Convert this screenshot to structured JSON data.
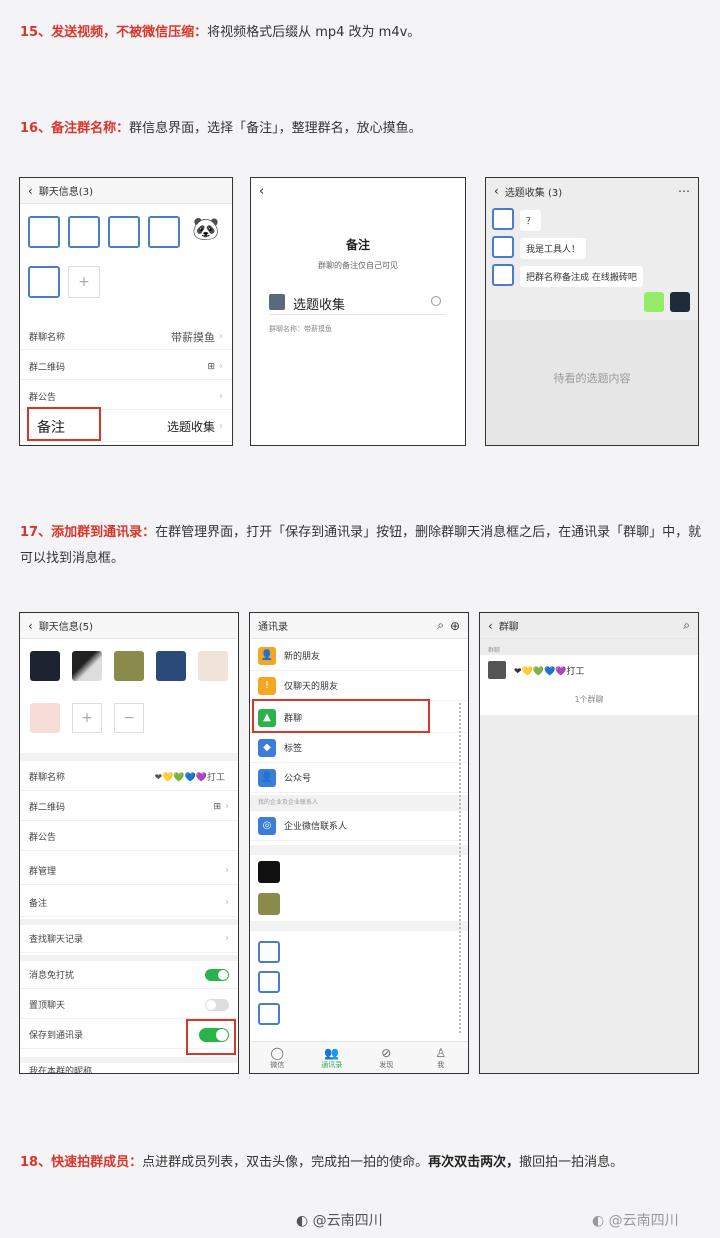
{
  "tip15": {
    "head": "15、发送视频，不被微信压缩：",
    "body": "将视频格式后缀从 mp4 改为 m4v。"
  },
  "tip16": {
    "head": "16、备注群名称：",
    "body": "群信息界面，选择「备注」，整理群名，放心摸鱼。"
  },
  "phone1": {
    "title": "聊天信息(3)",
    "rows": [
      {
        "label": "群聊名称",
        "value": "带薪摸鱼"
      },
      {
        "label": "群二维码",
        "value": "⊞"
      },
      {
        "label": "群公告",
        "value": ""
      }
    ],
    "remark_label": "备注",
    "remark_value": "选题收集"
  },
  "phone2": {
    "title": "备注",
    "subtitle": "群聊的备注仅自己可见",
    "input_value": "选题收集",
    "hint": "群聊名称：带薪摸鱼"
  },
  "phone3": {
    "title": "选题收集",
    "count": "(3)",
    "messages": [
      "？",
      "我是工具人！",
      "把群名称备注成 在线搬砖吧"
    ],
    "empty_hint": "待看的选题内容"
  },
  "tip17": {
    "head": "17、添加群到通讯录：",
    "body": "在群管理界面，打开「保存到通讯录」按钮，删除群聊天消息框之后，在通讯录「群聊」中，就可以找到消息框。"
  },
  "phone4": {
    "title": "聊天信息(5)",
    "rows": [
      {
        "label": "群聊名称",
        "value": "❤💛💚💙💜打工"
      },
      {
        "label": "群二维码",
        "value": "⊞"
      },
      {
        "label": "群公告",
        "value": ""
      },
      {
        "label": "群管理",
        "value": ""
      },
      {
        "label": "备注",
        "value": ""
      },
      {
        "label": "查找聊天记录",
        "value": ""
      }
    ],
    "toggles": [
      {
        "label": "消息免打扰",
        "on": true
      },
      {
        "label": "置顶聊天",
        "on": false
      },
      {
        "label": "保存到通讯录",
        "on": true
      }
    ],
    "last_row": "我在本群的昵称"
  },
  "phone5": {
    "title": "通讯录",
    "entries": [
      {
        "label": "新的朋友",
        "color": "#f5a623"
      },
      {
        "label": "仅聊天的朋友",
        "color": "#f5a623"
      },
      {
        "label": "群聊",
        "color": "#2bb34b"
      },
      {
        "label": "标签",
        "color": "#3b7dd8"
      },
      {
        "label": "公众号",
        "color": "#3b7dd8"
      }
    ],
    "section": "我的企业及企业联系人",
    "enterprise": "企业微信联系人",
    "tabs": [
      "微信",
      "通讯录",
      "发现",
      "我"
    ]
  },
  "phone6": {
    "title": "群聊",
    "section": "群聊",
    "group_name": "❤💛💚💙💜打工",
    "count_text": "1个群聊"
  },
  "tip18": {
    "head": "18、快速拍群成员：",
    "body": "点进群成员列表，双击头像，完成拍一拍的使命。",
    "bold": "再次双击两次，",
    "tail": "撤回拍一拍消息。"
  },
  "watermark": {
    "left": "@云南四川",
    "right": "@云南四川"
  }
}
